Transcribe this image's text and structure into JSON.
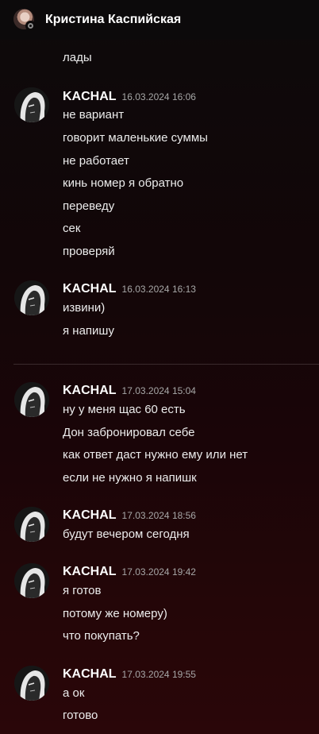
{
  "header": {
    "title": "Кристина Каспийская"
  },
  "prev_tail": "лады",
  "groups": [
    {
      "author": "KACHAL",
      "time": "16.03.2024 16:06",
      "lines": [
        "не вариант",
        "говорит маленькие суммы",
        "не работает",
        "кинь номер я обратно",
        "переведу",
        "сек",
        "проверяй"
      ]
    },
    {
      "author": "KACHAL",
      "time": "16.03.2024 16:13",
      "lines": [
        "извини)",
        "я напишу"
      ]
    },
    {
      "author": "KACHAL",
      "time": "17.03.2024 15:04",
      "lines": [
        "ну у меня щас 60 есть",
        "Дон забронировал себе",
        "как ответ даст нужно ему или нет",
        "если не нужно я напишк"
      ]
    },
    {
      "author": "KACHAL",
      "time": "17.03.2024 18:56",
      "lines": [
        "будут вечером сегодня"
      ]
    },
    {
      "author": "KACHAL",
      "time": "17.03.2024 19:42",
      "lines": [
        "я готов",
        "потому же номеру)",
        "что покупать?"
      ]
    },
    {
      "author": "KACHAL",
      "time": "17.03.2024 19:55",
      "lines": [
        "а ок",
        "готово"
      ]
    }
  ],
  "colors": {
    "accent_background": "#2a0609",
    "header_background": "#0c0a0b"
  }
}
